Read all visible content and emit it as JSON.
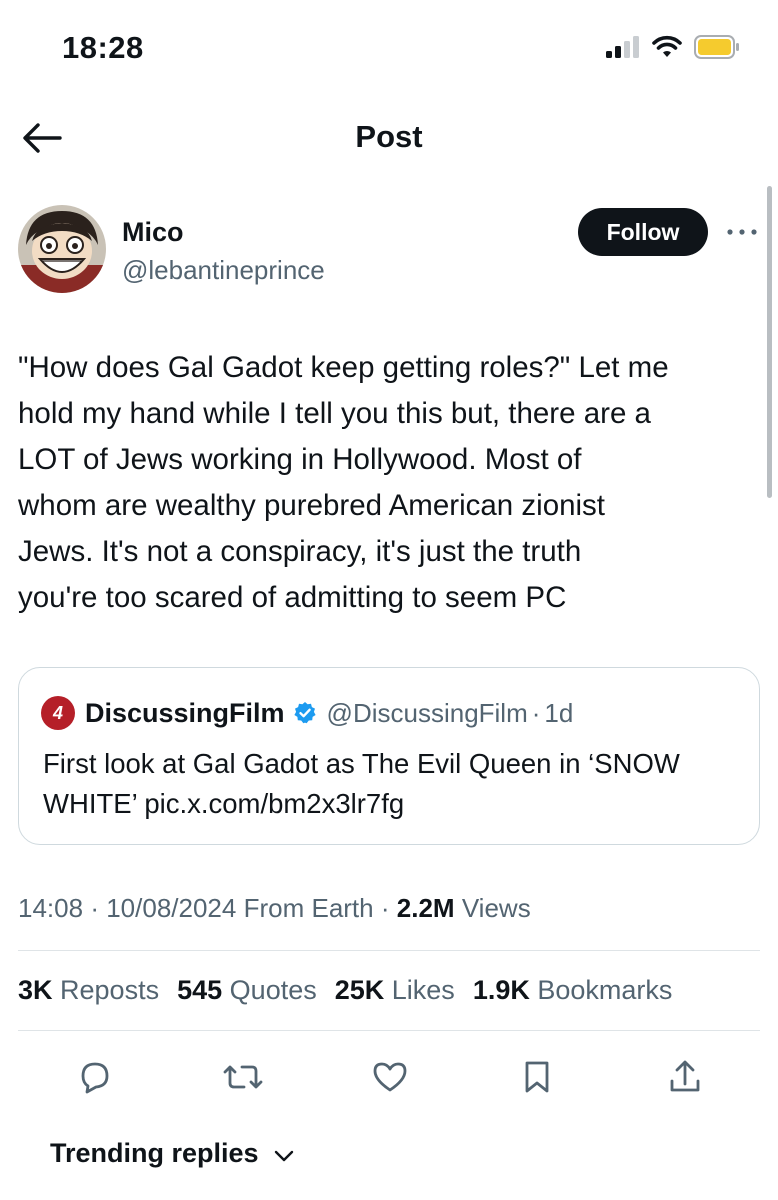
{
  "status_bar": {
    "time": "18:28"
  },
  "nav": {
    "title": "Post"
  },
  "author": {
    "display_name": "Mico",
    "handle": "@lebantineprince",
    "follow_label": "Follow"
  },
  "tweet": {
    "text": "\"How does Gal Gadot keep getting roles?\" Let me\nhold my hand while I tell you this but, there are a\nLOT of Jews working in Hollywood. Most of\nwhom are wealthy purebred American zionist\nJews. It's not a conspiracy, it's just the truth\nyou're too scared of admitting to seem PC"
  },
  "quote": {
    "avatar_text": "4",
    "name": "DiscussingFilm",
    "handle": "@DiscussingFilm",
    "separator": "·",
    "time": "1d",
    "text": "First look at Gal Gadot as The Evil Queen in ‘SNOW\nWHITE’ pic.x.com/bm2x3lr7fg"
  },
  "meta": {
    "time": "14:08",
    "date": "10/08/2024",
    "source": "From Earth",
    "separator": "·",
    "views_count": "2.2M",
    "views_label": "Views"
  },
  "stats": [
    {
      "count": "3K",
      "label": "Reposts"
    },
    {
      "count": "545",
      "label": "Quotes"
    },
    {
      "count": "25K",
      "label": "Likes"
    },
    {
      "count": "1.9K",
      "label": "Bookmarks"
    }
  ],
  "actions": [
    "reply-icon",
    "repost-icon",
    "like-icon",
    "bookmark-icon",
    "share-icon"
  ],
  "trending": {
    "label": "Trending replies"
  },
  "colors": {
    "text": "#0f1419",
    "secondary": "#536471",
    "border": "#cfd9de",
    "verified": "#1d9bf0",
    "battery": "#f5cb2e",
    "quote_avatar": "#b51f28"
  }
}
